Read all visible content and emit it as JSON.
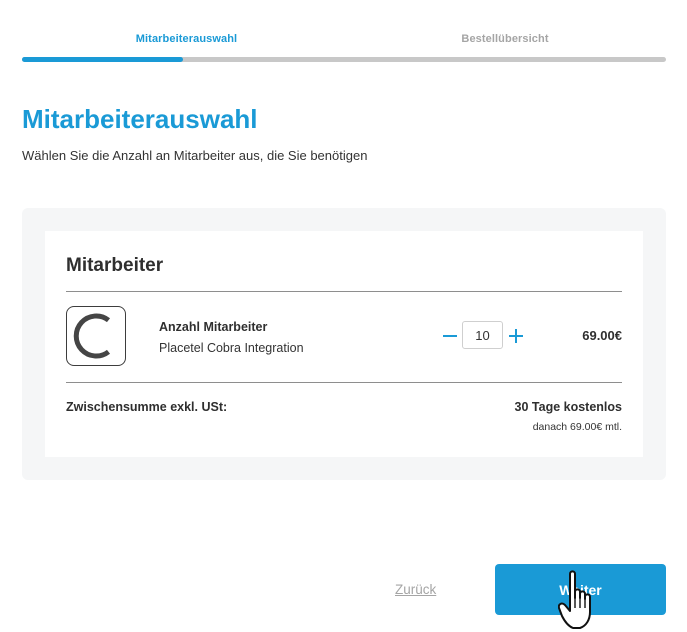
{
  "steps": [
    {
      "label": "Mitarbeiterauswahl",
      "active": true
    },
    {
      "label": "Bestellübersicht",
      "active": false
    }
  ],
  "progress": {
    "fraction": 0.25
  },
  "header": {
    "title": "Mitarbeiterauswahl",
    "subtitle": "Wählen Sie die Anzahl an Mitarbeiter aus, die Sie benötigen"
  },
  "card": {
    "title": "Mitarbeiter",
    "item": {
      "name": "Anzahl Mitarbeiter",
      "integration": "Placetel Cobra Integration",
      "quantity": "10",
      "price": "69.00€",
      "logo_icon": "cobra-logo-icon"
    },
    "subtotal_label": "Zwischensumme exkl. USt:",
    "trial_label": "30 Tage kostenlos",
    "trial_sub": "danach 69.00€ mtl."
  },
  "actions": {
    "back_label": "Zurück",
    "next_label": "Weiter"
  },
  "colors": {
    "accent": "#1a9ad6",
    "muted": "#a5a5a5",
    "panel_bg": "#f5f6f7"
  }
}
